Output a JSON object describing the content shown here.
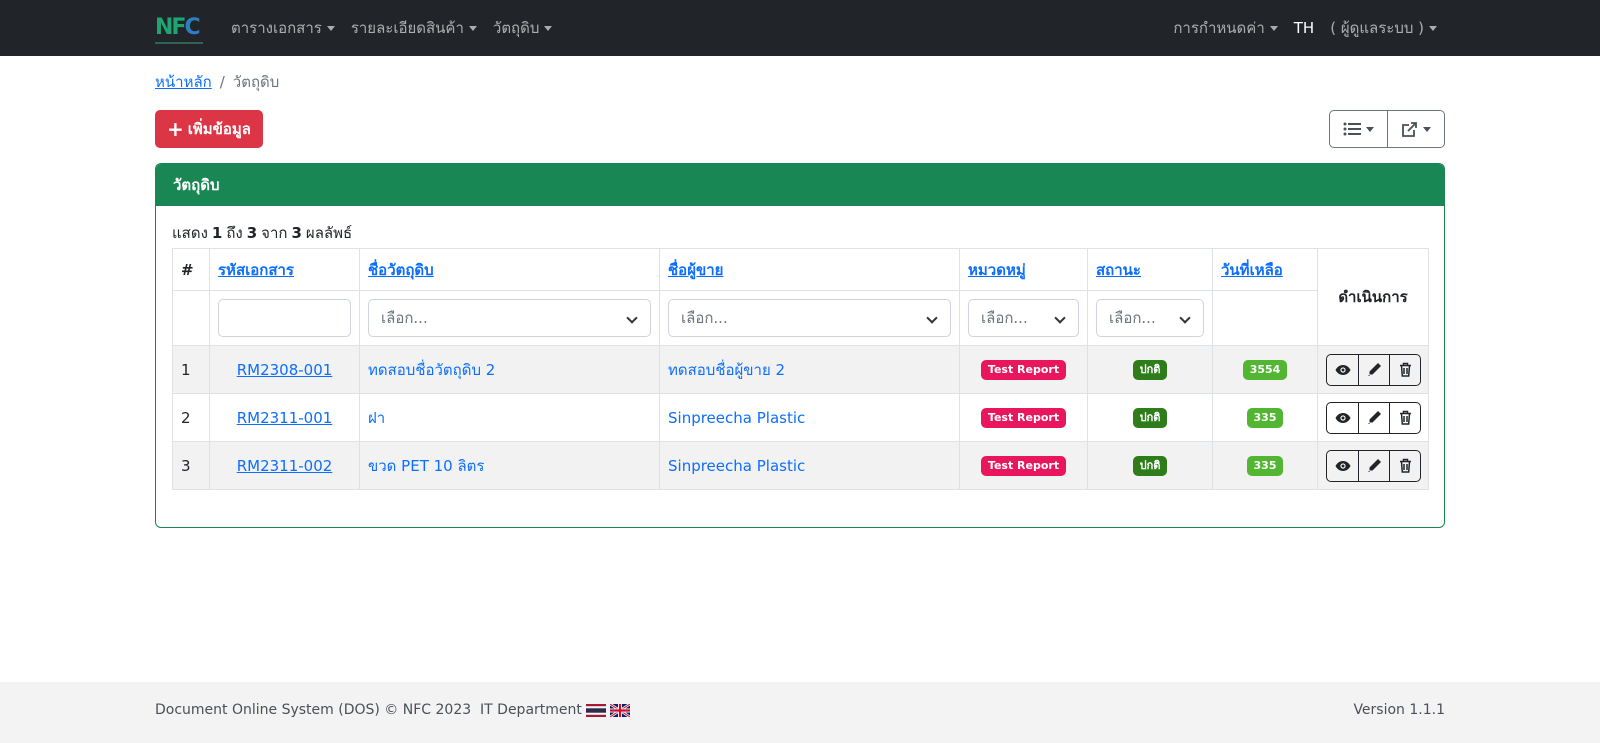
{
  "navbar": {
    "logo_text": "NFC",
    "menus": [
      {
        "label": "ตารางเอกสาร"
      },
      {
        "label": "รายละเอียดสินค้า"
      },
      {
        "label": "วัตถุดิบ"
      }
    ],
    "settings_label": "การกำหนดค่า",
    "lang": "TH",
    "user_label": "( ผู้ดูแลระบบ )"
  },
  "breadcrumb": {
    "home": "หน้าหลัก",
    "separator": "/",
    "current": "วัตถุดิบ"
  },
  "toolbar": {
    "add_label": "เพิ่มข้อมูล",
    "add_icon": "plus-icon",
    "columns_icon": "list-icon",
    "export_icon": "external-link-icon"
  },
  "card": {
    "title": "วัตถุดิบ",
    "summary_prefix": "แสดง",
    "summary_from": "1",
    "summary_to_word": "ถึง",
    "summary_to": "3",
    "summary_of_word": "จาก",
    "summary_total": "3",
    "summary_suffix": "ผลลัพธ์"
  },
  "table": {
    "headers": {
      "num": "#",
      "code": "รหัสเอกสาร",
      "name": "ชื่อวัตถุดิบ",
      "vendor": "ชื่อผู้ขาย",
      "category": "หมวดหมู่",
      "status": "สถานะ",
      "days_left": "วันที่เหลือ",
      "actions": "ดำเนินการ"
    },
    "filters": {
      "name_placeholder": "เลือก...",
      "vendor_placeholder": "เลือก...",
      "category_placeholder": "เลือก...",
      "status_placeholder": "เลือก..."
    },
    "rows": [
      {
        "num": "1",
        "code": "RM2308-001",
        "name": "ทดสอบชื่อวัตถุดิบ 2",
        "vendor": "ทดสอบชื่อผู้ขาย 2",
        "category": "Test Report",
        "status": "ปกติ",
        "days_left": "3554"
      },
      {
        "num": "2",
        "code": "RM2311-001",
        "name": "ฝา",
        "vendor": "Sinpreecha Plastic",
        "category": "Test Report",
        "status": "ปกติ",
        "days_left": "335"
      },
      {
        "num": "3",
        "code": "RM2311-002",
        "name": "ขวด PET 10 ลิตร",
        "vendor": "Sinpreecha Plastic",
        "category": "Test Report",
        "status": "ปกติ",
        "days_left": "335"
      }
    ],
    "colors": {
      "category_badge": "#e8175d",
      "status_badge": "#2e7d1a",
      "days_badge": "#52b633"
    }
  },
  "footer": {
    "text": "Document Online System (DOS) © NFC 2023  IT Department",
    "version": "Version 1.1.1"
  },
  "colors": {
    "navbar_bg": "#212529",
    "primary_green": "#198754",
    "danger": "#dc3545",
    "link": "#0d6efd"
  }
}
